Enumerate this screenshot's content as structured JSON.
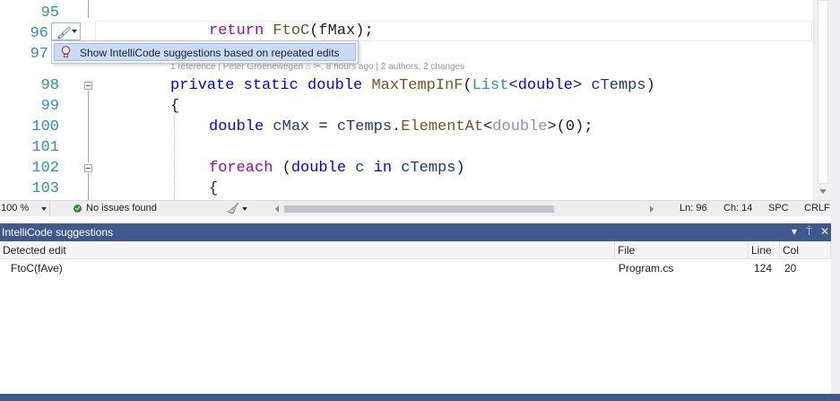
{
  "editor": {
    "line_numbers": [
      "95",
      "96",
      "97",
      "98",
      "99",
      "100",
      "101",
      "102",
      "103"
    ],
    "codelens": "1 reference | Peter Groenewegen ⌂ ✂, 8 hours ago | 2 authors, 2 changes",
    "lines": {
      "l96": {
        "kw": "return",
        "method": "FtoC",
        "rest": "(fMax);"
      },
      "l98": {
        "k1": "private",
        "k2": "static",
        "k3": "double",
        "method": "MaxTempInF",
        "open": "(",
        "type1": "List",
        "lt": "<",
        "k4": "double",
        "gt": ">",
        "param": "cTemps",
        "close": ")"
      },
      "l99": {
        "text": "{"
      },
      "l100": {
        "k1": "double",
        "var": "cMax",
        "eq": " = ",
        "param": "cTemps",
        "dot": ".",
        "method": "ElementAt",
        "lt": "<",
        "k2": "double",
        "gt": ">",
        "rest": "(0);"
      },
      "l102": {
        "k1": "foreach",
        "open": " (",
        "k2": "double",
        "var": " c ",
        "k3": "in",
        "param": " cTemps",
        "close": ")"
      },
      "l103": {
        "text": "{"
      }
    },
    "action_menu_item": "Show IntelliCode suggestions based on repeated edits"
  },
  "status_bar": {
    "zoom": "100 %",
    "issues": "No issues found",
    "ln": "Ln: 96",
    "ch": "Ch: 14",
    "spc": "SPC",
    "crlf": "CRLF"
  },
  "tool_window": {
    "title": "IntelliCode suggestions",
    "controls": {
      "dropdown": "▾",
      "pin": "⍑",
      "close": "✕"
    },
    "columns": [
      "Detected edit",
      "File",
      "Line",
      "Col"
    ],
    "rows": [
      {
        "edit": "FtoC(fAve)",
        "file": "Program.cs",
        "line": "124",
        "col": "20"
      }
    ]
  },
  "colors": {
    "keyword": "#0000ff",
    "return_keyword": "#8f08c4",
    "method": "#74531f",
    "type": "#2b91af",
    "parameter": "#1f377f",
    "line_number": "#2b91af",
    "tool_window_title": "#3f5a8a",
    "menu_highlight": "#c9dbf7",
    "ok_check": "#388a34"
  },
  "icons": [
    "brush-icon",
    "lightbulb-icon",
    "collapse-icon",
    "check-circle-icon",
    "broom-icon",
    "pin-icon",
    "close-icon",
    "dropdown-icon"
  ]
}
